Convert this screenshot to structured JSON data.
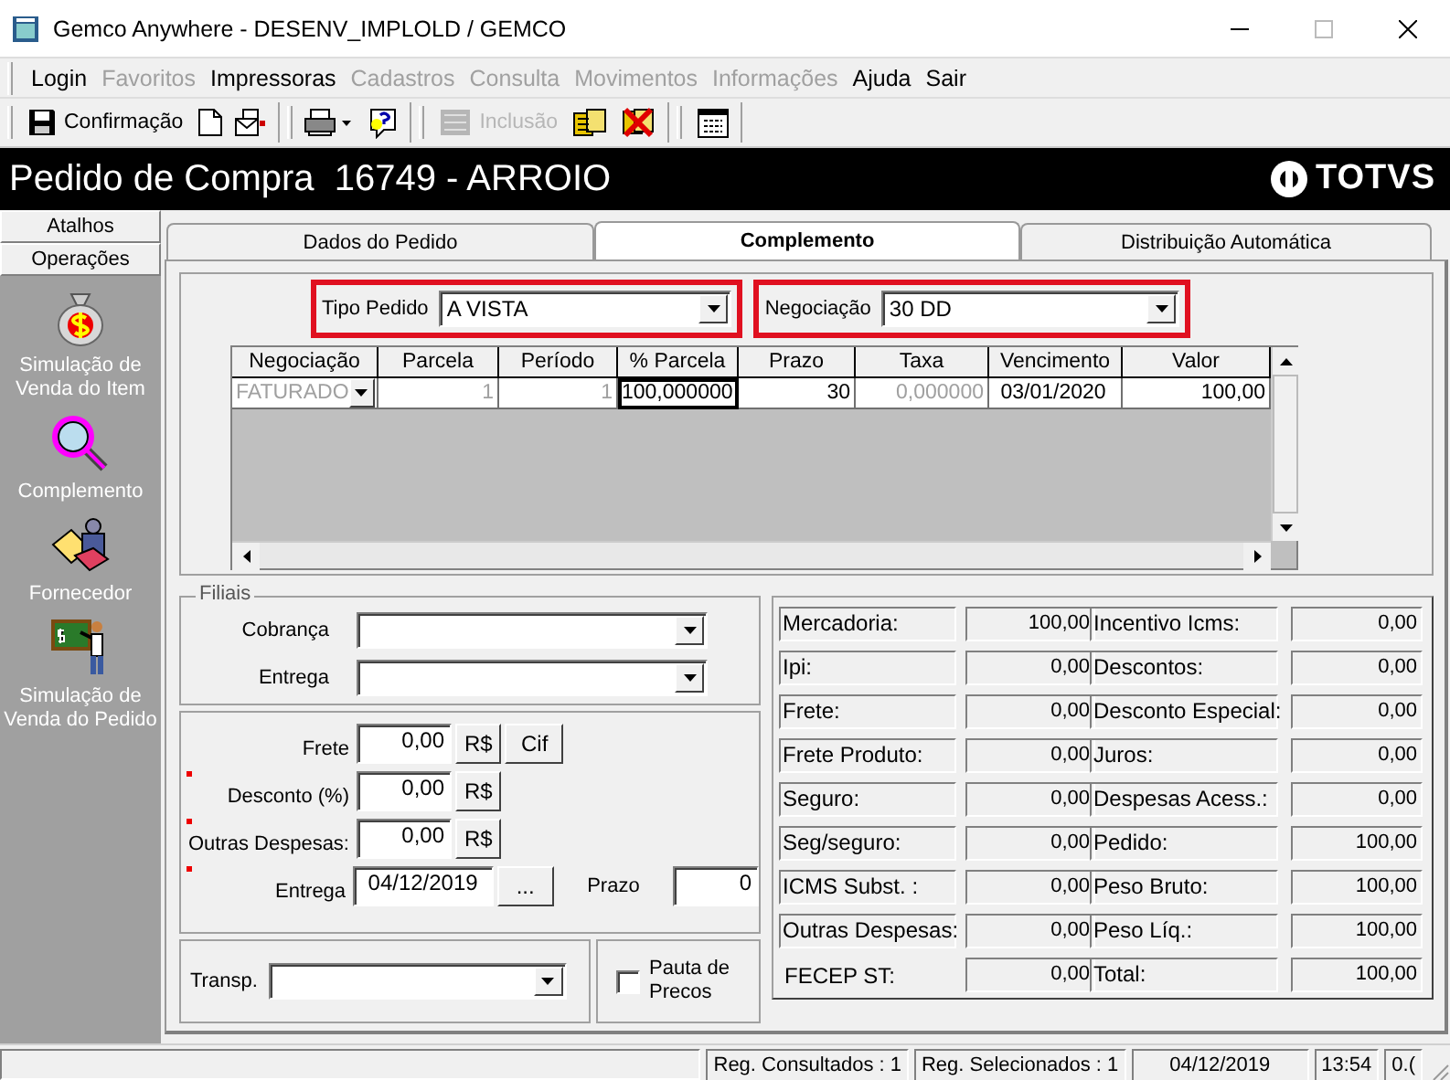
{
  "window": {
    "title": "Gemco Anywhere - DESENV_IMPLOLD / GEMCO"
  },
  "menu": [
    {
      "label": "Login",
      "disabled": false
    },
    {
      "label": "Favoritos",
      "disabled": true
    },
    {
      "label": "Impressoras",
      "disabled": false
    },
    {
      "label": "Cadastros",
      "disabled": true
    },
    {
      "label": "Consulta",
      "disabled": true
    },
    {
      "label": "Movimentos",
      "disabled": true
    },
    {
      "label": "Informações",
      "disabled": true
    },
    {
      "label": "Ajuda",
      "disabled": false
    },
    {
      "label": "Sair",
      "disabled": false
    }
  ],
  "toolbar": {
    "groups": [
      [
        {
          "kind": "save",
          "label": "Confirmação",
          "disabled": false
        },
        {
          "kind": "new"
        },
        {
          "kind": "letter"
        }
      ],
      [
        {
          "kind": "print"
        },
        {
          "kind": "help"
        }
      ],
      [
        {
          "kind": "add",
          "label": "Inclusão",
          "disabled": true
        },
        {
          "kind": "boxes"
        },
        {
          "kind": "delete"
        }
      ],
      [
        {
          "kind": "calendar"
        }
      ]
    ]
  },
  "header": {
    "title": "Pedido de Compra  16749 - ARROIO",
    "logo": "TOTVS"
  },
  "sidebar": {
    "sections": [
      {
        "label": "Atalhos"
      },
      {
        "label": "Operações"
      }
    ],
    "items": [
      {
        "kind": "money",
        "label": "Simulação de Venda do Item"
      },
      {
        "kind": "search",
        "label": "Complemento"
      },
      {
        "kind": "supplier",
        "label": "Fornecedor"
      },
      {
        "kind": "teacher",
        "label": "Simulação de Venda do Pedido"
      }
    ]
  },
  "tabs": [
    {
      "label": "Dados do Pedido",
      "selected": false
    },
    {
      "label": "Complemento",
      "selected": true
    },
    {
      "label": "Distribuição Automática",
      "selected": false
    }
  ],
  "tipo_pedido": {
    "label": "Tipo Pedido",
    "value": "A VISTA",
    "highlighted": true
  },
  "negociacao": {
    "label": "Negociação",
    "value": "30 DD",
    "highlighted": true
  },
  "grid": {
    "columns": [
      "Negociação",
      "Parcela",
      "Período",
      "% Parcela",
      "Prazo",
      "Taxa",
      "Vencimento",
      "Valor"
    ],
    "rows": [
      {
        "cells": [
          {
            "kind": "combo",
            "text": "FATURADO",
            "disabled": true,
            "focused": false
          },
          {
            "kind": "text",
            "text": "1",
            "disabled": true,
            "focused": false
          },
          {
            "kind": "text",
            "text": "1",
            "disabled": true,
            "focused": false
          },
          {
            "kind": "text",
            "text": "100,000000",
            "disabled": false,
            "focused": true
          },
          {
            "kind": "text",
            "text": "30",
            "disabled": false,
            "focused": false
          },
          {
            "kind": "text",
            "text": "0,000000",
            "disabled": true,
            "focused": false
          },
          {
            "kind": "date",
            "text": "03/01/2020",
            "disabled": false,
            "focused": false
          },
          {
            "kind": "text",
            "text": "100,00",
            "disabled": false,
            "focused": false
          }
        ]
      }
    ]
  },
  "filiais": {
    "title": "Filiais",
    "fields": [
      {
        "label": "Cobrança"
      },
      {
        "label": "Entrega"
      }
    ]
  },
  "valores": [
    {
      "label": "Frete",
      "value": "0,00",
      "buttons": [
        "R$",
        "Cif"
      ],
      "marked": false
    },
    {
      "label": "Desconto (%)",
      "value": "0,00",
      "buttons": [
        "R$"
      ],
      "marked": true
    },
    {
      "label": "Outras Despesas:",
      "value": "0,00",
      "buttons": [
        "R$"
      ],
      "marked": true
    },
    {
      "label": "Entrega",
      "value": "04/12/2019",
      "buttons": [
        "..."
      ],
      "marked": true
    }
  ],
  "prazo": {
    "label": "Prazo",
    "value": "0"
  },
  "transp": {
    "label": "Transp."
  },
  "pauta": {
    "label": "Pauta de Precos",
    "checked": false
  },
  "totals": [
    {
      "label": "Mercadoria:",
      "value": "100,00",
      "boxed": true
    },
    {
      "label": "Incentivo Icms:",
      "value": "0,00",
      "boxed": true
    },
    {
      "label": "Ipi:",
      "value": "0,00",
      "boxed": true
    },
    {
      "label": "Descontos:",
      "value": "0,00",
      "boxed": true
    },
    {
      "label": "Frete:",
      "value": "0,00",
      "boxed": true
    },
    {
      "label": "Desconto Especial:",
      "value": "0,00",
      "boxed": true
    },
    {
      "label": "Frete Produto:",
      "value": "0,00",
      "boxed": true
    },
    {
      "label": "Juros:",
      "value": "0,00",
      "boxed": true
    },
    {
      "label": "Seguro:",
      "value": "0,00",
      "boxed": true
    },
    {
      "label": "Despesas Acess.:",
      "value": "0,00",
      "boxed": true
    },
    {
      "label": "Seg/seguro:",
      "value": "0,00",
      "boxed": true
    },
    {
      "label": "Pedido:",
      "value": "100,00",
      "boxed": true
    },
    {
      "label": "ICMS Subst. :",
      "value": "0,00",
      "boxed": true
    },
    {
      "label": "Peso Bruto:",
      "value": "100,00",
      "boxed": true
    },
    {
      "label": "Outras Despesas:",
      "value": "0,00",
      "boxed": true
    },
    {
      "label": "Peso Líq.:",
      "value": "100,00",
      "boxed": true
    },
    {
      "label": "FECEP ST:",
      "value": "0,00",
      "boxed": false
    },
    {
      "label": "Total:",
      "value": "100,00",
      "boxed": true
    }
  ],
  "status_bar": [
    "Reg. Consultados : 1",
    "Reg. Selecionados : 1",
    "04/12/2019",
    "13:54",
    "0.("
  ]
}
